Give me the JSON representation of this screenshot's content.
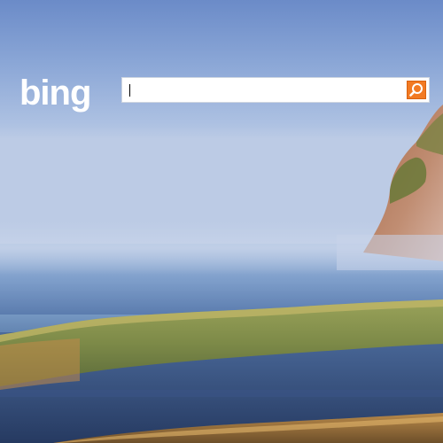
{
  "brand": {
    "logo_text": "bing"
  },
  "search": {
    "value": "",
    "placeholder": ""
  },
  "icons": {
    "search_button": "search-icon"
  },
  "colors": {
    "search_button": "#f27a23",
    "logo": "#ffffff",
    "sky": "#87a4d4",
    "water": "#2f466d"
  }
}
